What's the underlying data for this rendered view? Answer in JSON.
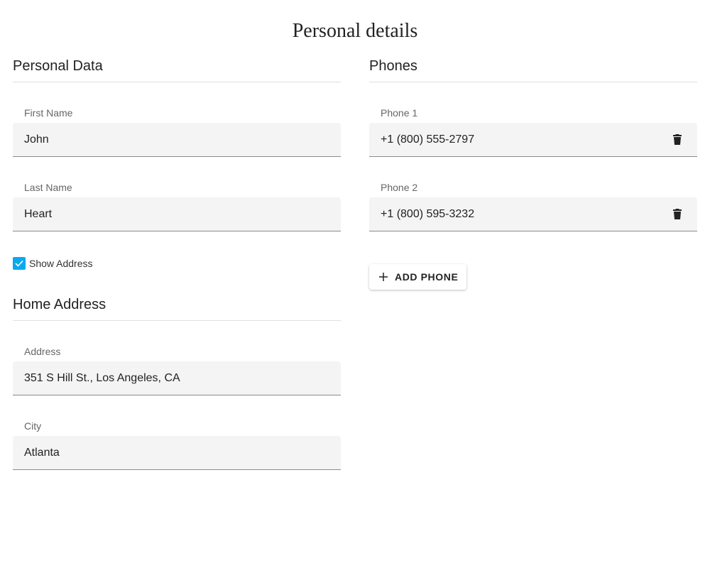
{
  "title": "Personal details",
  "personal": {
    "heading": "Personal Data",
    "first_name": {
      "label": "First Name",
      "value": "John"
    },
    "last_name": {
      "label": "Last Name",
      "value": "Heart"
    },
    "show_address": {
      "label": "Show Address",
      "checked": true
    }
  },
  "address": {
    "heading": "Home Address",
    "address": {
      "label": "Address",
      "value": "351 S Hill St., Los Angeles, CA"
    },
    "city": {
      "label": "City",
      "value": "Atlanta"
    }
  },
  "phones": {
    "heading": "Phones",
    "items": [
      {
        "label": "Phone 1",
        "value": "+1 (800) 555-2797",
        "icon": "trash-icon"
      },
      {
        "label": "Phone 2",
        "value": "+1 (800) 595-3232",
        "icon": "trash-icon"
      }
    ],
    "add_label": "ADD PHONE"
  },
  "colors": {
    "accent": "#0ba8ee"
  }
}
